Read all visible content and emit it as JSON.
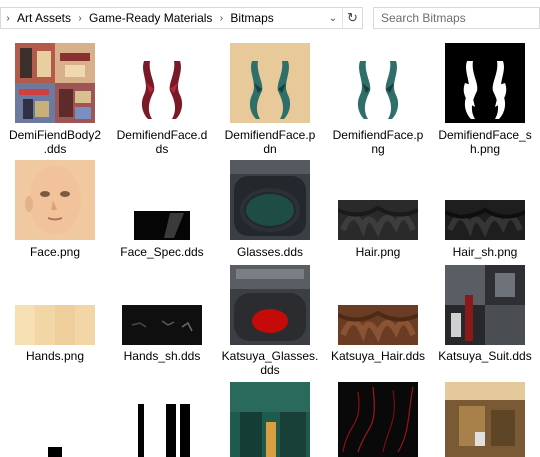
{
  "breadcrumb": {
    "items": [
      "Art Assets",
      "Game-Ready Materials",
      "Bitmaps"
    ]
  },
  "search": {
    "placeholder": "Search Bitmaps"
  },
  "files": [
    {
      "name": "DemiFiendBody2.dds",
      "line1": "DemiFiendBody2",
      "line2": ".dds"
    },
    {
      "name": "DemifiendFace.dds",
      "line1": "DemifiendFace.d",
      "line2": "ds"
    },
    {
      "name": "DemifiendFace.pdn",
      "line1": "DemifiendFace.p",
      "line2": "dn"
    },
    {
      "name": "DemifiendFace.png",
      "line1": "DemifiendFace.p",
      "line2": "ng"
    },
    {
      "name": "DemifiendFace_sh.png",
      "line1": "DemifiendFace_s",
      "line2": "h.png"
    },
    {
      "name": "Face.png",
      "line1": "Face.png",
      "line2": ""
    },
    {
      "name": "Face_Spec.dds",
      "line1": "Face_Spec.dds",
      "line2": ""
    },
    {
      "name": "Glasses.dds",
      "line1": "Glasses.dds",
      "line2": ""
    },
    {
      "name": "Hair.png",
      "line1": "Hair.png",
      "line2": ""
    },
    {
      "name": "Hair_sh.png",
      "line1": "Hair_sh.png",
      "line2": ""
    },
    {
      "name": "Hands.png",
      "line1": "Hands.png",
      "line2": ""
    },
    {
      "name": "Hands_sh.dds",
      "line1": "Hands_sh.dds",
      "line2": ""
    },
    {
      "name": "Katsuya_Glasses.dds",
      "line1": "Katsuya_Glasses.",
      "line2": "dds"
    },
    {
      "name": "Katsuya_Hair.dds",
      "line1": "Katsuya_Hair.dds",
      "line2": ""
    },
    {
      "name": "Katsuya_Suit.dds",
      "line1": "Katsuya_Suit.dds",
      "line2": ""
    }
  ]
}
